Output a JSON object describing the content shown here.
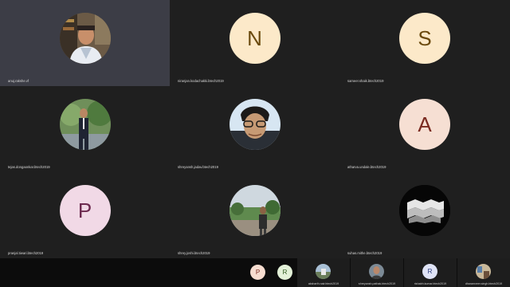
{
  "participants": [
    {
      "name": "anuj.rakshe.vf",
      "type": "photo",
      "photo": "man-suit-office"
    },
    {
      "name": "niranjan.kodachakki.btech2019",
      "type": "letter",
      "letter": "N",
      "bg": "#fce9c9",
      "fg": "#6b4a0e"
    },
    {
      "name": "sameer.shaik.btech2019",
      "type": "letter",
      "letter": "S",
      "bg": "#fce9c9",
      "fg": "#6b4a0e"
    },
    {
      "name": "tejas.dongaonkar.btech2019",
      "type": "photo",
      "photo": "man-standing-trees"
    },
    {
      "name": "shreyansh.jadav.btech2019",
      "type": "photo",
      "photo": "man-glasses-portrait"
    },
    {
      "name": "atharva.undale.btech2019",
      "type": "letter",
      "letter": "A",
      "bg": "#f6dfd3",
      "fg": "#7a2a20"
    },
    {
      "name": "pranjal.tiwari.btech2019",
      "type": "letter",
      "letter": "P",
      "bg": "#f1d9e6",
      "fg": "#6d2a4f"
    },
    {
      "name": "shrey.joshi.btech2019",
      "type": "photo",
      "photo": "man-outdoor-landscape"
    },
    {
      "name": "suhas.mithe.btech2019",
      "type": "photo",
      "photo": "white-pattern-dark"
    }
  ],
  "self_avatars": [
    {
      "letter": "P",
      "bg": "#f7ddd0",
      "fg": "#7a2a20"
    },
    {
      "letter": "R",
      "bg": "#e3f1d8",
      "fg": "#2f5a1e"
    }
  ],
  "strip": [
    {
      "name": "aksharth.nair.btech2019",
      "type": "photo",
      "photo": "outdoor-building"
    },
    {
      "name": "shreyansh.pathak.btech2019",
      "type": "photo",
      "photo": "man-portrait"
    },
    {
      "name": "rishabh.kumar.btech2019",
      "type": "letter",
      "letter": "R",
      "bg": "#dfe3f6",
      "fg": "#2a3a7a"
    },
    {
      "name": "dharamveer.singh.btech2019",
      "type": "photo",
      "photo": "indoor-scene"
    }
  ]
}
